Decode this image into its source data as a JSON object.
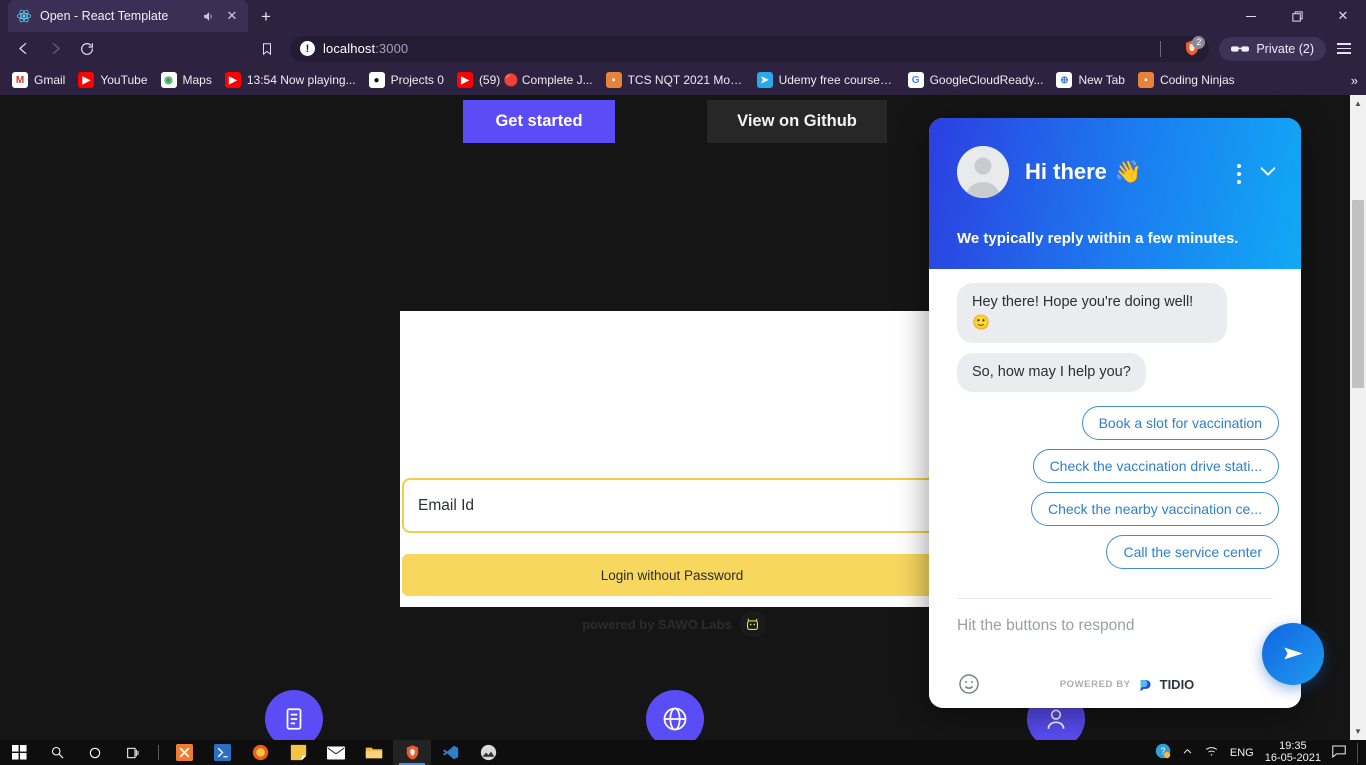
{
  "browser": {
    "tab": {
      "title": "Open - React Template",
      "favicon": "react-icon",
      "audio_icon": "speaker-icon",
      "close_icon": "close-icon"
    },
    "new_tab_label": "+",
    "window_controls": {
      "minimize": "—",
      "maximize": "❑",
      "close": "✕"
    },
    "nav": {
      "back": "back-arrow",
      "forward": "forward-arrow",
      "reload": "reload-icon",
      "bookmark": "bookmark-icon"
    },
    "omnibox": {
      "url_host": "localhost",
      "url_port": ":3000",
      "info_icon": "!"
    },
    "shields": {
      "badge_count": "2"
    },
    "private_label": "Private (2)",
    "bookmarks": [
      {
        "label": "Gmail",
        "icon": "M",
        "color": "#ffffff",
        "fg": "#d93025"
      },
      {
        "label": "YouTube",
        "icon": "▶",
        "color": "#ff0000",
        "fg": "#ffffff"
      },
      {
        "label": "Maps",
        "icon": "◉",
        "color": "#ffffff",
        "fg": "#34a853"
      },
      {
        "label": "13:54 Now playing...",
        "icon": "▶",
        "color": "#ff0000",
        "fg": "#ffffff"
      },
      {
        "label": "Projects 0",
        "icon": "●",
        "color": "#ffffff",
        "fg": "#1b1b1b"
      },
      {
        "label": "(59) 🔴 Complete J...",
        "icon": "▶",
        "color": "#ff0000",
        "fg": "#ffffff"
      },
      {
        "label": "TCS NQT 2021 Moc...",
        "icon": "■",
        "color": "#e8833a",
        "fg": "#ffffff"
      },
      {
        "label": "Udemy free courses...",
        "icon": "➤",
        "color": "#29a9eb",
        "fg": "#ffffff"
      },
      {
        "label": "GoogleCloudReady...",
        "icon": "G",
        "color": "#ffffff",
        "fg": "#4285f4"
      },
      {
        "label": "New Tab",
        "icon": "⊕",
        "color": "#ffffff",
        "fg": "#3b7dd8"
      },
      {
        "label": "Coding Ninjas",
        "icon": "■",
        "color": "#e8833a",
        "fg": "#ffffff"
      }
    ],
    "bookmarks_overflow": "»"
  },
  "page": {
    "hero_buttons": {
      "primary": "Get started",
      "secondary": "View on Github"
    },
    "login": {
      "email_placeholder": "Email Id",
      "login_button": "Login without Password",
      "powered_by": "powered by SAWO Labs"
    },
    "feature_icons": [
      {
        "name": "document-icon",
        "glyph": "☰"
      },
      {
        "name": "globe-icon",
        "glyph": "⊕"
      },
      {
        "name": "person-icon",
        "glyph": "℗"
      }
    ],
    "accent_color": "#5a4df5",
    "form_accent_color": "#f8d75f"
  },
  "chat": {
    "title": "Hi there",
    "title_emoji": "👋",
    "subtitle": "We typically reply within a few minutes.",
    "menu_icon": "kebab-menu-icon",
    "minimize_icon": "chevron-down-icon",
    "messages": [
      "Hey there! Hope you're doing well! 🙂",
      "So, how may I help you?"
    ],
    "quick_replies": [
      "Book a slot for vaccination",
      "Check the vaccination drive stati...",
      "Check the nearby vaccination ce...",
      "Call the service center"
    ],
    "input_placeholder": "Hit the buttons to respond",
    "emoji_icon": "smiley-icon",
    "powered_by_label": "POWERED BY",
    "powered_by_brand": "TIDIO",
    "send_icon": "send-icon",
    "header_gradient_start": "#2c3fe0",
    "header_gradient_end": "#11a9f5"
  },
  "taskbar": {
    "items": [
      {
        "name": "start-button",
        "glyph": "⊞",
        "color": "#ffffff"
      },
      {
        "name": "search-icon",
        "glyph": "⚲",
        "color": "#ffffff"
      },
      {
        "name": "cortana-icon",
        "glyph": "○",
        "color": "#ffffff"
      },
      {
        "name": "task-view-icon",
        "glyph": "☰",
        "color": "#ffffff"
      },
      {
        "name": "xampp-icon",
        "glyph": "✖",
        "color": "#f07c30"
      },
      {
        "name": "powershell-icon",
        "glyph": "⌫",
        "color": "#2b6fc2"
      },
      {
        "name": "firefox-icon",
        "glyph": "◕",
        "color": "#e8631a"
      },
      {
        "name": "sticky-notes-icon",
        "glyph": "◧",
        "color": "#f5c542"
      },
      {
        "name": "mail-icon",
        "glyph": "✉",
        "color": "#ffffff"
      },
      {
        "name": "file-explorer-icon",
        "glyph": "▬",
        "color": "#f5b942"
      },
      {
        "name": "brave-icon",
        "glyph": "▲",
        "color": "#eb5c28"
      },
      {
        "name": "vscode-icon",
        "glyph": "◈",
        "color": "#2f7fd0"
      },
      {
        "name": "photos-icon",
        "glyph": "◔",
        "color": "#d8d8d8"
      }
    ],
    "tray": {
      "help_icon": "help-icon",
      "chevron_icon": "⌃",
      "network_icon": "wifi-icon",
      "language": "ENG",
      "time": "19:35",
      "date": "16-05-2021",
      "notification_icon": "notification-icon"
    }
  }
}
